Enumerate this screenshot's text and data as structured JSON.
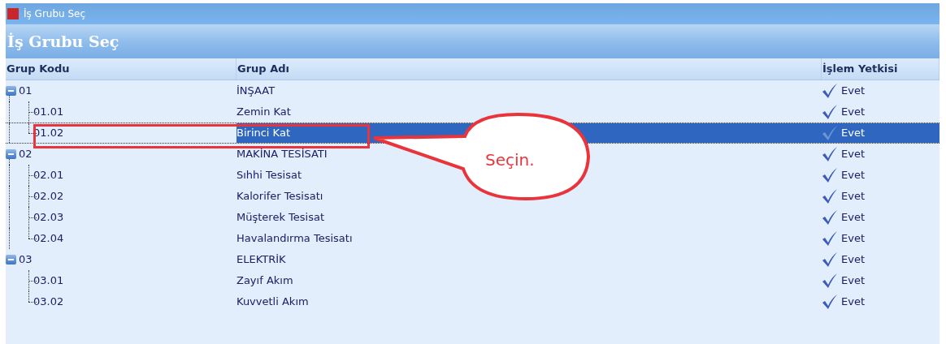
{
  "window": {
    "title": "İş Grubu Seç"
  },
  "heading": "İş Grubu Seç",
  "table": {
    "columns": [
      "Grup Kodu",
      "Grup Adı",
      "İşlem Yetkisi"
    ],
    "rows": [
      {
        "code": "01",
        "name": "İNŞAAT",
        "permission": "Evet",
        "expanded": true,
        "selected": false,
        "children": [
          {
            "code": "01.01",
            "name": "Zemin Kat",
            "permission": "Evet",
            "selected": false
          },
          {
            "code": "01.02",
            "name": "Birinci Kat",
            "permission": "Evet",
            "selected": true
          }
        ]
      },
      {
        "code": "02",
        "name": "MAKİNA TESİSATI",
        "permission": "Evet",
        "expanded": true,
        "selected": false,
        "children": [
          {
            "code": "02.01",
            "name": "Sıhhi Tesisat",
            "permission": "Evet",
            "selected": false
          },
          {
            "code": "02.02",
            "name": "Kalorifer Tesisatı",
            "permission": "Evet",
            "selected": false
          },
          {
            "code": "02.03",
            "name": "Müşterek Tesisat",
            "permission": "Evet",
            "selected": false
          },
          {
            "code": "02.04",
            "name": "Havalandırma Tesisatı",
            "permission": "Evet",
            "selected": false
          }
        ]
      },
      {
        "code": "03",
        "name": "ELEKTRİK",
        "permission": "Evet",
        "expanded": true,
        "selected": false,
        "children": [
          {
            "code": "03.01",
            "name": "Zayıf Akım",
            "permission": "Evet",
            "selected": false
          },
          {
            "code": "03.02",
            "name": "Kuvvetli Akım",
            "permission": "Evet",
            "selected": false
          }
        ]
      }
    ]
  },
  "annotation": {
    "text": "Seçin."
  }
}
